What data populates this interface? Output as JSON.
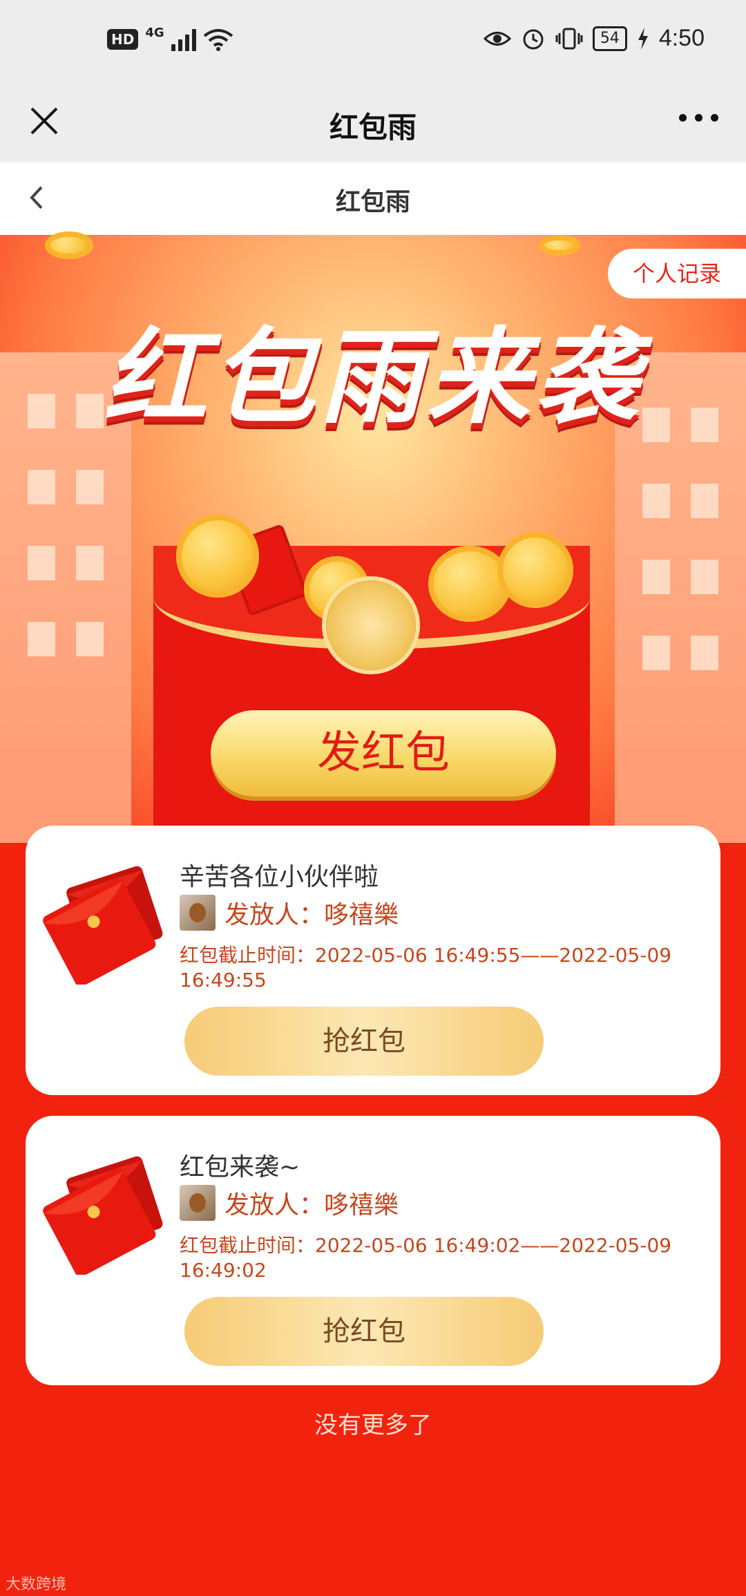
{
  "status_bar": {
    "hd": "HD",
    "network": "4G",
    "battery": "54",
    "time": "4:50",
    "icons": [
      "eye-icon",
      "alarm-icon",
      "vibrate-icon",
      "charging-icon"
    ]
  },
  "wechat_nav": {
    "title": "红包雨",
    "close_icon": "close-icon",
    "more_icon": "more-icon"
  },
  "page_header": {
    "title": "红包雨",
    "back_icon": "chevron-left-icon"
  },
  "hero": {
    "title": "红包雨来袭",
    "record_button": "个人记录",
    "send_button": "发红包"
  },
  "cards": [
    {
      "title": "辛苦各位小伙伴啦",
      "sender_label": "发放人：",
      "sender_name": "哆禧樂",
      "deadline": "红包截止时间：2022-05-06 16:49:55——2022-05-09 16:49:55",
      "button": "抢红包"
    },
    {
      "title": "红包来袭~",
      "sender_label": "发放人：",
      "sender_name": "哆禧樂",
      "deadline": "红包截止时间：2022-05-06 16:49:02——2022-05-09 16:49:02",
      "button": "抢红包"
    }
  ],
  "footer": {
    "no_more": "没有更多了",
    "watermark": "大数跨境"
  },
  "colors": {
    "primary_red": "#f2230e",
    "gold": "#f8d663",
    "text_brown": "#c8461c"
  }
}
